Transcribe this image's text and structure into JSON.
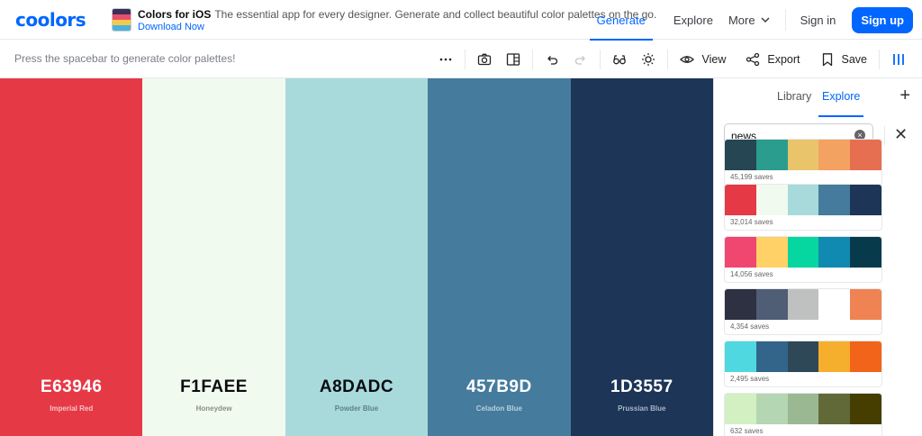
{
  "header": {
    "logo": "coolors",
    "promo": {
      "title": "Colors for iOS",
      "description": "The essential app for every designer. Generate and collect beautiful color palettes on the go.",
      "link": "Download Now"
    },
    "nav": {
      "generate": "Generate",
      "explore": "Explore",
      "more": "More",
      "signin": "Sign in",
      "signup": "Sign up"
    }
  },
  "toolbar": {
    "hint": "Press the spacebar to generate color palettes!",
    "view_label": "View",
    "export_label": "Export",
    "save_label": "Save"
  },
  "palette": [
    {
      "hex": "E63946",
      "name": "Imperial Red",
      "color": "#E63946",
      "text_color": "#ffffff",
      "sub_color": "#f6c4c8"
    },
    {
      "hex": "F1FAEE",
      "name": "Honeydew",
      "color": "#F1FAEE",
      "text_color": "#0a0c10",
      "sub_color": "#8a8f85"
    },
    {
      "hex": "A8DADC",
      "name": "Powder Blue",
      "color": "#A8DADC",
      "text_color": "#0a0c10",
      "sub_color": "#5f8182"
    },
    {
      "hex": "457B9D",
      "name": "Celadon Blue",
      "color": "#457B9D",
      "text_color": "#ffffff",
      "sub_color": "#b9d0de"
    },
    {
      "hex": "1D3557",
      "name": "Prussian Blue",
      "color": "#1D3557",
      "text_color": "#ffffff",
      "sub_color": "#a9b6c8"
    }
  ],
  "panel": {
    "tabs": [
      "Library",
      "Explore"
    ],
    "active_tab": "Explore",
    "search_value": "news",
    "palettes": [
      {
        "saves": "45,199 saves",
        "colors": [
          "#264653",
          "#2a9d8f",
          "#e9c46a",
          "#f4a261",
          "#e76f51"
        ]
      },
      {
        "saves": "32,014 saves",
        "colors": [
          "#e63946",
          "#f1faee",
          "#a8dadc",
          "#457b9d",
          "#1d3557"
        ]
      },
      {
        "saves": "14,056 saves",
        "colors": [
          "#ef476f",
          "#ffd166",
          "#06d6a0",
          "#118ab2",
          "#073b4c"
        ]
      },
      {
        "saves": "4,354 saves",
        "colors": [
          "#2d3142",
          "#4f5d75",
          "#bfc0c0",
          "#ffffff",
          "#ef8354"
        ]
      },
      {
        "saves": "2,495 saves",
        "colors": [
          "#50d8e0",
          "#33658a",
          "#2f4858",
          "#f6ae2d",
          "#f26419"
        ]
      },
      {
        "saves": "632 saves",
        "colors": [
          "#d3f0c2",
          "#b5d6b2",
          "#9ab892",
          "#626939",
          "#453e00"
        ]
      }
    ]
  },
  "colors": {
    "accent": "#0066ff"
  }
}
